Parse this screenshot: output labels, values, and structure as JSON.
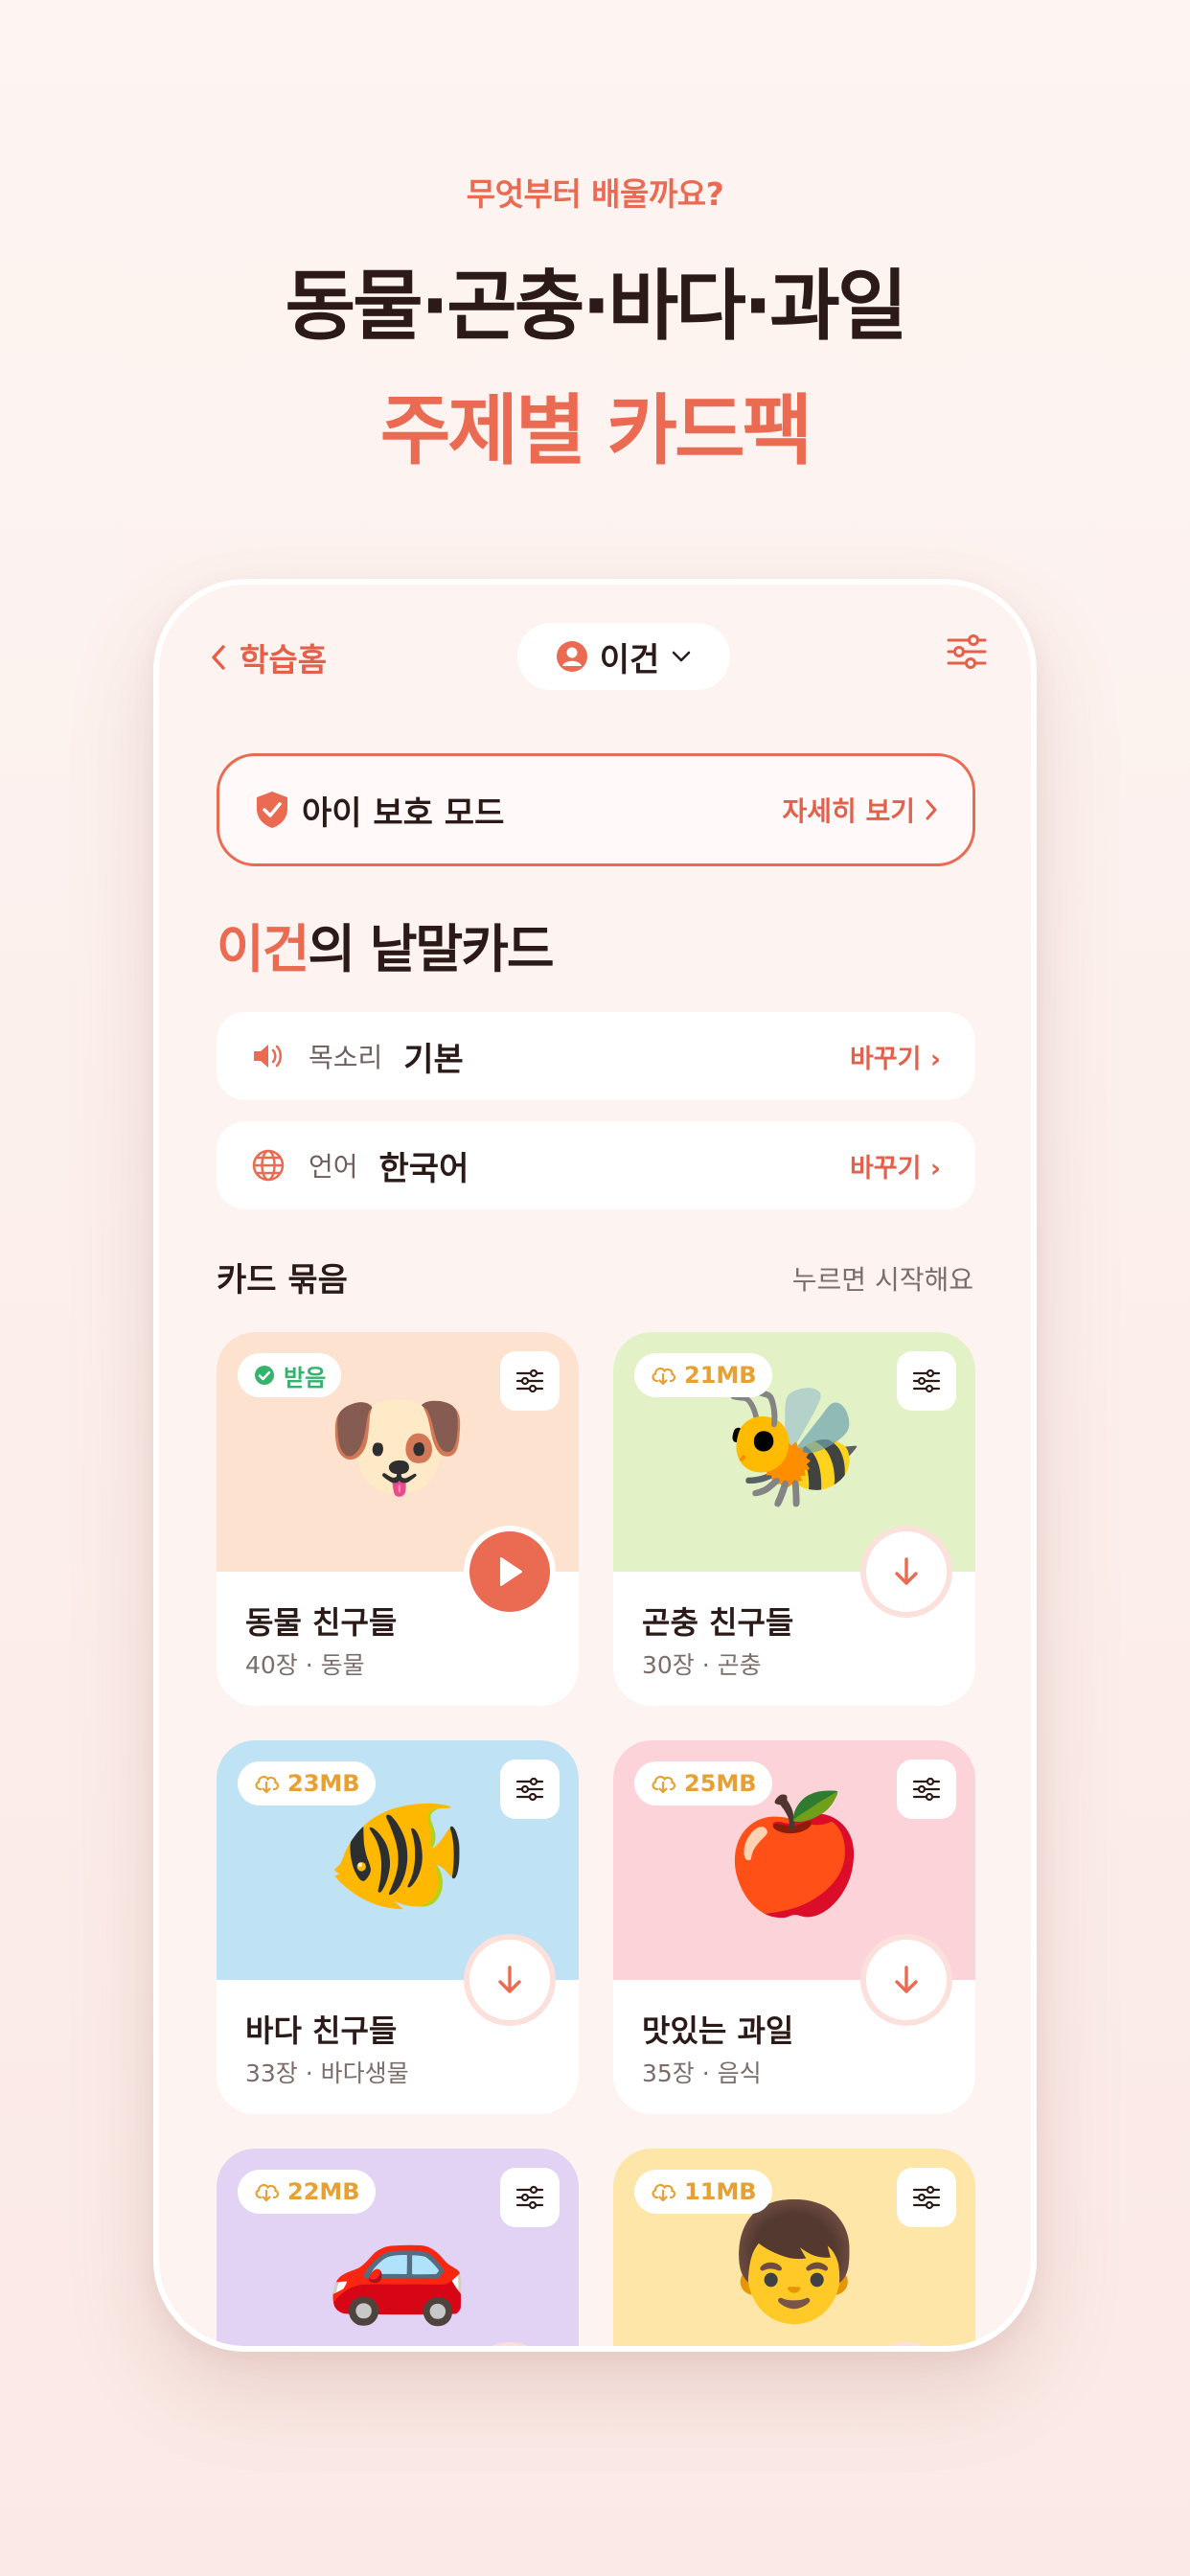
{
  "promo": {
    "kicker": "무엇부터 배울까요?",
    "headline": "동물·곤충·바다·과일",
    "headline2": "주제별 카드팩"
  },
  "colors": {
    "accent": "#ea6a52",
    "background": "#fdf4f2",
    "download_badge": "#e6a034",
    "done_badge": "#35b26b"
  },
  "topbar": {
    "back_label": "학습홈",
    "profile_name": "이건",
    "profile_icon": "person-circle-icon",
    "menu_icon": "sliders-icon"
  },
  "safe_mode": {
    "title": "아이 보호 모드",
    "link": "자세히 보기",
    "icon": "shield-check-icon"
  },
  "page": {
    "owner": "이건",
    "title_suffix": "의 낱말카드"
  },
  "settings": [
    {
      "icon": "speaker-icon",
      "label": "목소리",
      "value": "기본",
      "action": "바꾸기 ›"
    },
    {
      "icon": "globe-icon",
      "label": "언어",
      "value": "한국어",
      "action": "바꾸기 ›"
    }
  ],
  "section": {
    "title": "카드 묶음",
    "hint": "누르면 시작해요"
  },
  "cards": [
    {
      "badge": "받음",
      "badge_type": "downloaded",
      "emoji": "🐶",
      "bg": "#fde3cf",
      "title": "동물 친구들",
      "meta": "40장 · 동물",
      "action": "play"
    },
    {
      "badge": "21MB",
      "badge_type": "download",
      "emoji": "🐝",
      "bg": "#e2f2c6",
      "title": "곤충 친구들",
      "meta": "30장 · 곤충",
      "action": "download"
    },
    {
      "badge": "23MB",
      "badge_type": "download",
      "emoji": "🐠",
      "bg": "#bfe2f4",
      "title": "바다 친구들",
      "meta": "33장 · 바다생물",
      "action": "download"
    },
    {
      "badge": "25MB",
      "badge_type": "download",
      "emoji": "🍎",
      "bg": "#fdd3da",
      "title": "맛있는 과일",
      "meta": "35장 · 음식",
      "action": "download"
    },
    {
      "badge": "22MB",
      "badge_type": "download",
      "emoji": "🚗",
      "bg": "#e2d3f5",
      "title": "",
      "meta": "",
      "action": "download"
    },
    {
      "badge": "11MB",
      "badge_type": "download",
      "emoji": "👦",
      "bg": "#fee6a8",
      "title": "",
      "meta": "",
      "action": "download"
    }
  ]
}
